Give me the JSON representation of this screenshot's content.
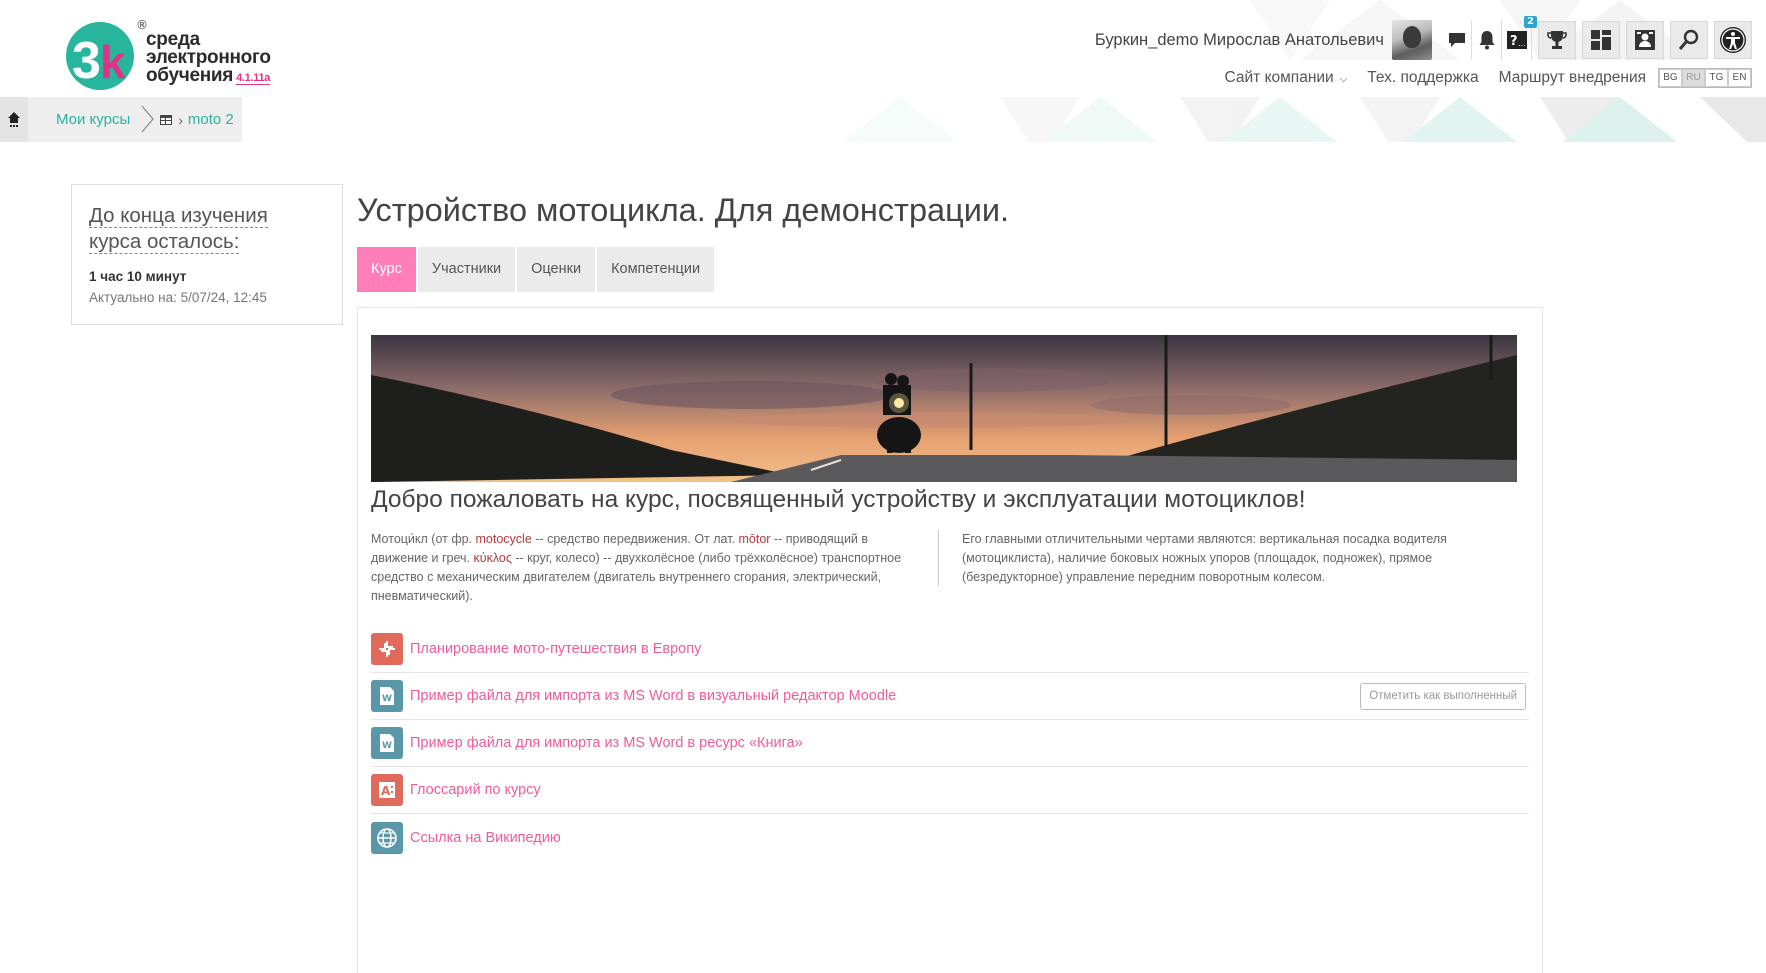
{
  "logo": {
    "line1": "среда",
    "line2": "электронного",
    "line3": "обучения",
    "version": "4.1.11a",
    "reg": "®"
  },
  "user": {
    "name": "Буркин_demo Мирослав Анатольевич",
    "help_badge": "2"
  },
  "nav": {
    "company_site": "Сайт компании",
    "support": "Тех. поддержка",
    "route": "Маршрут внедрения",
    "languages": [
      "BG",
      "RU",
      "TG",
      "EN"
    ],
    "active_language": "RU"
  },
  "breadcrumb": {
    "my_courses": "Мои курсы",
    "course": "moto 2"
  },
  "time_left": {
    "title": "До конца изучения курса осталось:",
    "value": "1 час 10 минут",
    "updated": "Актуально на: 5/07/24, 12:45"
  },
  "course": {
    "title": "Устройство мотоцикла. Для демонстрации.",
    "tabs": [
      "Курс",
      "Участники",
      "Оценки",
      "Компетенции"
    ],
    "welcome": "Добро пожаловать на курс, посвященный устройству и эксплуатации мотоциклов!",
    "left_text": {
      "p1": "Мотоци́кл (от фр. ",
      "t1": "motocycle",
      "p2": " -- средство передвижения. От лат. ",
      "t2": "mōtor",
      "p3": " -- приводящий в движение и греч. ",
      "t3": "κύκλος",
      "p4": " -- круг, колесо) -- двухколёсное (либо трёхколёсное) транспортное средство с механическим двигателем (двигатель внутреннего сгорания, электрический, пневматический)."
    },
    "right_text": "Его главными отличительными чертами являются: вертикальная посадка водителя (мотоциклиста), наличие боковых ножных упоров (площадок, подножек), прямое (безредукторное) управление передним поворотным колесом.",
    "activities": [
      {
        "label": "Планирование мото-путешествия в Европу",
        "icon": "workshop-icon",
        "color": "#e06b5d"
      },
      {
        "label": "Пример файла для импорта из MS Word в визуальный редактор Moodle",
        "icon": "word-file-icon",
        "color": "#5a97a8"
      },
      {
        "label": "Пример файла для импорта из MS Word в ресурс «Книга»",
        "icon": "word-file-icon",
        "color": "#5a97a8"
      },
      {
        "label": "Глоссарий по курсу",
        "icon": "glossary-icon",
        "color": "#e06b5d"
      },
      {
        "label": "Ссылка на Википедию",
        "icon": "url-globe-icon",
        "color": "#5a97a8"
      }
    ],
    "complete_button": "Отметить как выполненный"
  }
}
